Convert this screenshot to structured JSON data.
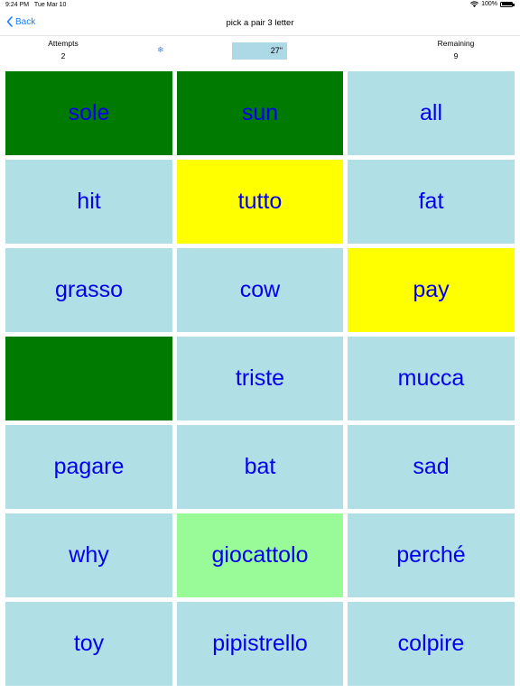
{
  "status_bar": {
    "time": "9:24 PM",
    "date": "Tue Mar 10",
    "battery": "100%",
    "wifi_icon": "wifi-icon",
    "battery_icon": "battery-icon"
  },
  "nav": {
    "back_label": "Back",
    "back_icon": "chevron-left-icon",
    "title": "pick a pair 3 letter"
  },
  "stats": {
    "attempts_label": "Attempts",
    "attempts_value": "2",
    "freeze_icon": "❄",
    "timer": "27\"",
    "remaining_label": "Remaining",
    "remaining_value": "9"
  },
  "colors": {
    "tile_default": "#b0dfe5",
    "tile_matched": "#007a00",
    "tile_selected": "#ffff00",
    "tile_highlight": "#98fb98",
    "word_text": "#0000ee",
    "accent": "#1a7cf5"
  },
  "tiles": [
    {
      "word": "sole",
      "state": "green"
    },
    {
      "word": "sun",
      "state": "green"
    },
    {
      "word": "all",
      "state": "lightblue"
    },
    {
      "word": "hit",
      "state": "lightblue"
    },
    {
      "word": "tutto",
      "state": "yellow"
    },
    {
      "word": "fat",
      "state": "lightblue"
    },
    {
      "word": "grasso",
      "state": "lightblue"
    },
    {
      "word": "cow",
      "state": "lightblue"
    },
    {
      "word": "pay",
      "state": "yellow"
    },
    {
      "word": "",
      "state": "green"
    },
    {
      "word": "triste",
      "state": "lightblue"
    },
    {
      "word": "mucca",
      "state": "lightblue"
    },
    {
      "word": "pagare",
      "state": "lightblue"
    },
    {
      "word": "bat",
      "state": "lightblue"
    },
    {
      "word": "sad",
      "state": "lightblue"
    },
    {
      "word": "why",
      "state": "lightblue"
    },
    {
      "word": "giocattolo",
      "state": "lightgreen"
    },
    {
      "word": "perché",
      "state": "lightblue"
    },
    {
      "word": "toy",
      "state": "lightblue"
    },
    {
      "word": "pipistrello",
      "state": "lightblue"
    },
    {
      "word": "colpire",
      "state": "lightblue"
    }
  ]
}
